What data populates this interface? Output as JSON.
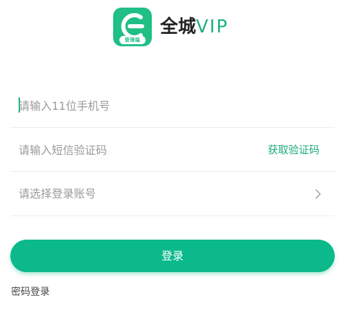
{
  "brand": {
    "icon_label": "管理端",
    "name_cn": "全城",
    "name_vip": "VIP",
    "accent_color": "#1fbf86"
  },
  "form": {
    "phone_placeholder": "请输入11位手机号",
    "code_placeholder": "请输入短信验证码",
    "get_code_label": "获取验证码",
    "account_placeholder": "请选择登录账号",
    "chevron_icon": "chevron-right-icon"
  },
  "actions": {
    "login_label": "登录",
    "login_color": "#0bb98b",
    "password_login_label": "密码登录"
  }
}
